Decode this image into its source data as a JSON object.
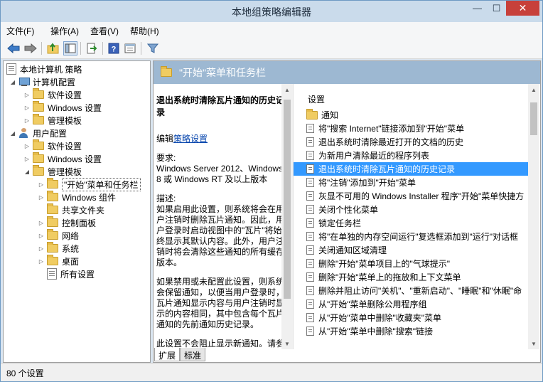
{
  "window": {
    "title": "本地组策略编辑器",
    "minimize_symbol": "—",
    "maximize_symbol": "☐",
    "close_symbol": "✕"
  },
  "menu": [
    "文件(F)",
    "操作(A)",
    "查看(V)",
    "帮助(H)"
  ],
  "toolbar": [
    "back-arrow-icon",
    "forward-arrow-icon",
    "up-folder-icon",
    "show-hide-tree-icon",
    "export-list-icon",
    "help-icon",
    "properties-icon",
    "filter-icon"
  ],
  "tree": [
    {
      "label": "本地计算机 策略",
      "level": 0,
      "icon": "doc"
    },
    {
      "label": "计算机配置",
      "level": 1,
      "icon": "pc",
      "arrow": "down"
    },
    {
      "label": "软件设置",
      "level": 2,
      "icon": "folder",
      "arrow": "right"
    },
    {
      "label": "Windows 设置",
      "level": 2,
      "icon": "folder",
      "arrow": "right"
    },
    {
      "label": "管理模板",
      "level": 2,
      "icon": "folder",
      "arrow": "right"
    },
    {
      "label": "用户配置",
      "level": 1,
      "icon": "user",
      "arrow": "down"
    },
    {
      "label": "软件设置",
      "level": 2,
      "icon": "folder",
      "arrow": "right"
    },
    {
      "label": "Windows 设置",
      "level": 2,
      "icon": "folder",
      "arrow": "right"
    },
    {
      "label": "管理模板",
      "level": 2,
      "icon": "folder",
      "arrow": "down"
    },
    {
      "label": "\"开始\"菜单和任务栏",
      "level": 3,
      "icon": "folder",
      "arrow": "right",
      "selected": true
    },
    {
      "label": "Windows 组件",
      "level": 3,
      "icon": "folder",
      "arrow": "right"
    },
    {
      "label": "共享文件夹",
      "level": 3,
      "icon": "folder"
    },
    {
      "label": "控制面板",
      "level": 3,
      "icon": "folder",
      "arrow": "right"
    },
    {
      "label": "网络",
      "level": 3,
      "icon": "folder",
      "arrow": "right"
    },
    {
      "label": "系统",
      "level": 3,
      "icon": "folder",
      "arrow": "right"
    },
    {
      "label": "桌面",
      "level": 3,
      "icon": "folder",
      "arrow": "right"
    },
    {
      "label": "所有设置",
      "level": 3,
      "icon": "doc"
    }
  ],
  "header_title": "\"开始\"菜单和任务栏",
  "description": {
    "title": "退出系统时清除瓦片通知的历史记录",
    "edit_prefix": "编辑",
    "edit_link": "策略设置",
    "requirements": "要求:\nWindows Server 2012、Windows 8 或 Windows RT 及以上版本",
    "desc": "描述:\n如果启用此设置，则系统将会在用户注销时删除瓦片通知。因此，用户登录时启动视图中的\"瓦片\"将始终显示其默认内容。此外，用户注销时将会清除这些通知的所有缓存版本。",
    "disabled": "如果禁用或未配置此设置，则系统会保留通知，以便当用户登录时，瓦片通知显示内容与用户注销时显示的内容相同，其中包含每个瓦片通知的先前通知历史记录。",
    "more": "此设置不会阻止显示新通知。请参"
  },
  "settings_header": "设置",
  "settings": [
    {
      "label": "通知",
      "type": "folder"
    },
    {
      "label": "将\"搜索 Internet\"链接添加到\"开始\"菜单",
      "type": "setting"
    },
    {
      "label": "退出系统时清除最近打开的文档的历史",
      "type": "setting"
    },
    {
      "label": "为新用户清除最近的程序列表",
      "type": "setting"
    },
    {
      "label": "退出系统时清除瓦片通知的历史记录",
      "type": "setting",
      "selected": true
    },
    {
      "label": "将\"注销\"添加到\"开始\"菜单",
      "type": "setting"
    },
    {
      "label": "灰显不可用的 Windows Installer 程序\"开始\"菜单快捷方",
      "type": "setting"
    },
    {
      "label": "关闭个性化菜单",
      "type": "setting"
    },
    {
      "label": "锁定任务栏",
      "type": "setting"
    },
    {
      "label": "将\"在单独的内存空间运行\"复选框添加到\"运行\"对话框",
      "type": "setting"
    },
    {
      "label": "关闭通知区域清理",
      "type": "setting"
    },
    {
      "label": "删除\"开始\"菜单项目上的\"气球提示\"",
      "type": "setting"
    },
    {
      "label": "删除\"开始\"菜单上的拖放和上下文菜单",
      "type": "setting"
    },
    {
      "label": "删除并阻止访问\"关机\"、\"重新启动\"、\"睡眠\"和\"休眠\"命",
      "type": "setting"
    },
    {
      "label": "从\"开始\"菜单删除公用程序组",
      "type": "setting"
    },
    {
      "label": "从\"开始\"菜单中删除\"收藏夹\"菜单",
      "type": "setting"
    },
    {
      "label": "从\"开始\"菜单中删除\"搜索\"链接",
      "type": "setting"
    }
  ],
  "tabs": [
    "扩展",
    "标准"
  ],
  "status": "80 个设置"
}
